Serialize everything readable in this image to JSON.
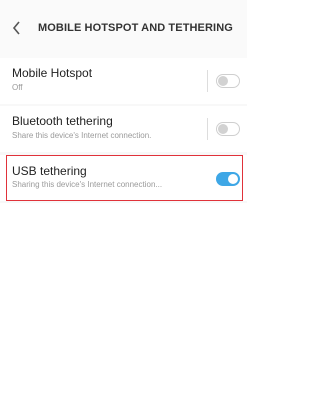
{
  "header": {
    "title": "MOBILE HOTSPOT AND TETHERING",
    "back_icon": "chevron-left-icon"
  },
  "rows": [
    {
      "title": "Mobile Hotspot",
      "subtitle": "Off",
      "toggle_on": false
    },
    {
      "title": "Bluetooth tethering",
      "subtitle": "Share this device's Internet connection.",
      "toggle_on": false
    },
    {
      "title": "USB tethering",
      "subtitle": "Sharing this device's Internet connection...",
      "toggle_on": true
    }
  ],
  "colors": {
    "accent": "#3ea7e6",
    "highlight": "#e0323a"
  }
}
